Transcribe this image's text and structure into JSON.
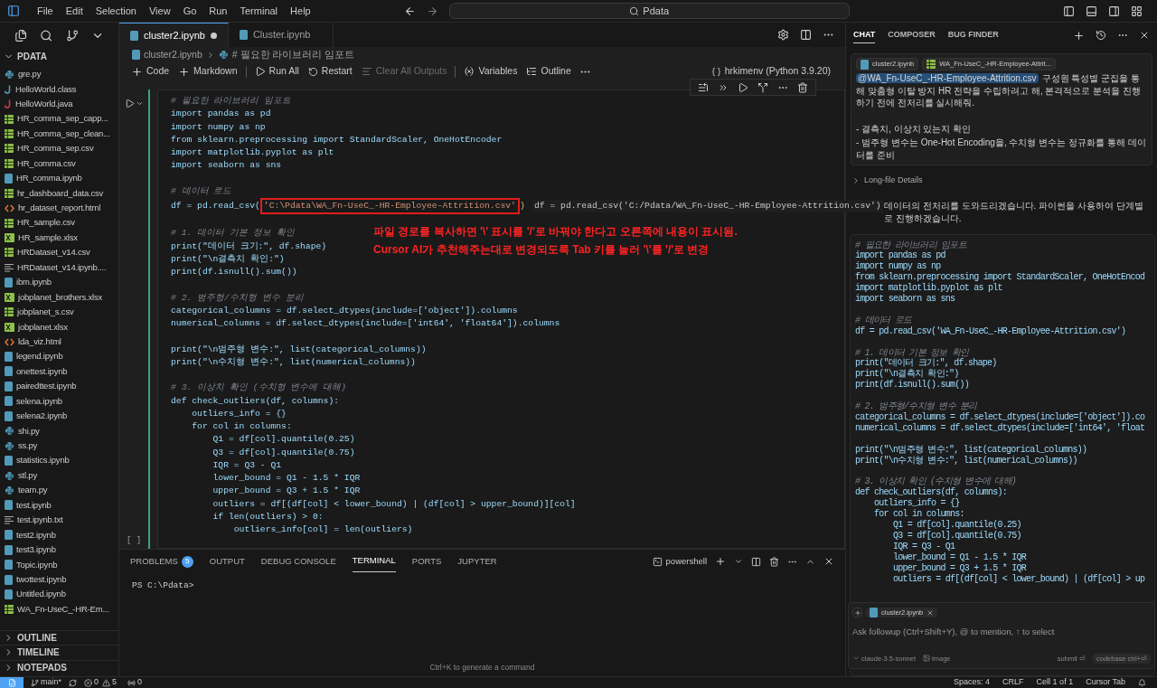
{
  "title_bar": {
    "menu": [
      "File",
      "Edit",
      "Selection",
      "View",
      "Go",
      "Run",
      "Terminal",
      "Help"
    ],
    "search": "Pdata"
  },
  "explorer": {
    "title": "PDATA",
    "files": [
      {
        "name": "gre.py",
        "kind": "py"
      },
      {
        "name": "HelloWorld.class",
        "kind": "class"
      },
      {
        "name": "HelloWorld.java",
        "kind": "java"
      },
      {
        "name": "HR_comma_sep_capp...",
        "kind": "csv"
      },
      {
        "name": "HR_comma_sep_clean...",
        "kind": "csv"
      },
      {
        "name": "HR_comma_sep.csv",
        "kind": "csv"
      },
      {
        "name": "HR_comma.csv",
        "kind": "csv"
      },
      {
        "name": "HR_comma.ipynb",
        "kind": "ipynb"
      },
      {
        "name": "hr_dashboard_data.csv",
        "kind": "csv"
      },
      {
        "name": "hr_dataset_report.html",
        "kind": "html"
      },
      {
        "name": "HR_sample.csv",
        "kind": "csv"
      },
      {
        "name": "HR_sample.xlsx",
        "kind": "xlsx"
      },
      {
        "name": "HRDataset_v14.csv",
        "kind": "csv"
      },
      {
        "name": "HRDataset_v14.ipynb....",
        "kind": "txt"
      },
      {
        "name": "ibm.ipynb",
        "kind": "ipynb"
      },
      {
        "name": "jobplanet_brothers.xlsx",
        "kind": "xlsx"
      },
      {
        "name": "jobplanet_s.csv",
        "kind": "csv"
      },
      {
        "name": "jobplanet.xlsx",
        "kind": "xlsx"
      },
      {
        "name": "lda_viz.html",
        "kind": "html"
      },
      {
        "name": "legend.ipynb",
        "kind": "ipynb"
      },
      {
        "name": "onettest.ipynb",
        "kind": "ipynb"
      },
      {
        "name": "pairedttest.ipynb",
        "kind": "ipynb"
      },
      {
        "name": "selena.ipynb",
        "kind": "ipynb"
      },
      {
        "name": "selena2.ipynb",
        "kind": "ipynb"
      },
      {
        "name": "shi.py",
        "kind": "py"
      },
      {
        "name": "ss.py",
        "kind": "py"
      },
      {
        "name": "statistics.ipynb",
        "kind": "ipynb"
      },
      {
        "name": "stl.py",
        "kind": "py"
      },
      {
        "name": "team.py",
        "kind": "py"
      },
      {
        "name": "test.ipynb",
        "kind": "ipynb"
      },
      {
        "name": "test.ipynb.txt",
        "kind": "txt"
      },
      {
        "name": "test2.ipynb",
        "kind": "ipynb"
      },
      {
        "name": "test3.ipynb",
        "kind": "ipynb"
      },
      {
        "name": "Topic.ipynb",
        "kind": "ipynb"
      },
      {
        "name": "twottest.ipynb",
        "kind": "ipynb"
      },
      {
        "name": "Untitled.ipynb",
        "kind": "ipynb"
      },
      {
        "name": "WA_Fn-UseC_-HR-Em...",
        "kind": "csv"
      }
    ],
    "sections": [
      "OUTLINE",
      "TIMELINE",
      "NOTEPADS"
    ]
  },
  "editor": {
    "tabs": [
      {
        "label": "cluster2.ipynb",
        "selected": true,
        "modified": true
      },
      {
        "label": "Cluster.ipynb",
        "selected": false,
        "modified": false
      }
    ],
    "breadcrumb": [
      "cluster2.ipynb",
      "# 필요한 라이브러리 임포트"
    ],
    "toolbar": [
      {
        "label": "Code",
        "disabled": false
      },
      {
        "label": "Markdown",
        "disabled": false
      },
      {
        "label": "Run All",
        "disabled": false
      },
      {
        "label": "Restart",
        "disabled": false
      },
      {
        "label": "Clear All Outputs",
        "disabled": true
      },
      {
        "label": "Variables",
        "disabled": false
      },
      {
        "label": "Outline",
        "disabled": false
      }
    ],
    "kernel": "hrkimenv (Python 3.9.20)",
    "cell_status": "[ ]",
    "code": [
      {
        "kind": "comment",
        "text": "# 필요한 라이브러리 임포트"
      },
      {
        "kind": "code",
        "text": "import pandas as pd"
      },
      {
        "kind": "code",
        "text": "import numpy as np"
      },
      {
        "kind": "code",
        "text": "from sklearn.preprocessing import StandardScaler, OneHotEncoder"
      },
      {
        "kind": "code",
        "text": "import matplotlib.pyplot as plt"
      },
      {
        "kind": "code",
        "text": "import seaborn as sns"
      },
      {
        "kind": "blank"
      },
      {
        "kind": "comment",
        "text": "# 데이터 로드"
      },
      {
        "kind": "edit",
        "before": "df = pd.read_csv(",
        "boxed": "'C:\\Pdata\\WA_Fn-UseC_-HR-Employee-Attrition.csv'",
        "after": ")",
        "ghost": "df = pd.read_csv('C:/Pdata/WA_Fn-UseC_-HR-Employee-Attrition.csv')"
      },
      {
        "kind": "blank"
      },
      {
        "kind": "comment",
        "text": "# 1. 데이터 기본 정보 확인"
      },
      {
        "kind": "code",
        "text": "print(\"데이터 크기:\", df.shape)"
      },
      {
        "kind": "code",
        "text": "print(\"\\n결측치 확인:\")"
      },
      {
        "kind": "code",
        "text": "print(df.isnull().sum())"
      },
      {
        "kind": "blank"
      },
      {
        "kind": "comment",
        "text": "# 2. 범주형/수치형 변수 분리"
      },
      {
        "kind": "code",
        "text": "categorical_columns = df.select_dtypes(include=['object']).columns"
      },
      {
        "kind": "code",
        "text": "numerical_columns = df.select_dtypes(include=['int64', 'float64']).columns"
      },
      {
        "kind": "blank"
      },
      {
        "kind": "code",
        "text": "print(\"\\n범주형 변수:\", list(categorical_columns))"
      },
      {
        "kind": "code",
        "text": "print(\"\\n수치형 변수:\", list(numerical_columns))"
      },
      {
        "kind": "blank"
      },
      {
        "kind": "comment",
        "text": "# 3. 이상치 확인 (수치형 변수에 대해)"
      },
      {
        "kind": "code",
        "text": "def check_outliers(df, columns):"
      },
      {
        "kind": "code",
        "text": "    outliers_info = {}"
      },
      {
        "kind": "code",
        "text": "    for col in columns:"
      },
      {
        "kind": "code",
        "text": "        Q1 = df[col].quantile(0.25)"
      },
      {
        "kind": "code",
        "text": "        Q3 = df[col].quantile(0.75)"
      },
      {
        "kind": "code",
        "text": "        IQR = Q3 - Q1"
      },
      {
        "kind": "code",
        "text": "        lower_bound = Q1 - 1.5 * IQR"
      },
      {
        "kind": "code",
        "text": "        upper_bound = Q3 + 1.5 * IQR"
      },
      {
        "kind": "code",
        "text": "        outliers = df[(df[col] < lower_bound) | (df[col] > upper_bound)][col]"
      },
      {
        "kind": "code",
        "text": "        if len(outliers) > 0:"
      },
      {
        "kind": "code",
        "text": "            outliers_info[col] = len(outliers)"
      }
    ],
    "annotation": [
      "파일 경로를 복사하면 '\\' 표시를 '/'로 바꿔야 한다고 오른쪽에 내용이 표시됨.",
      "Cursor AI가 추천해주는대로 변경되도록 Tab 키를 눌러 '\\'를 '/'로 변경"
    ]
  },
  "panel": {
    "tabs": [
      {
        "label": "PROBLEMS",
        "selected": false,
        "badge": "5"
      },
      {
        "label": "OUTPUT",
        "selected": false
      },
      {
        "label": "DEBUG CONSOLE",
        "selected": false
      },
      {
        "label": "TERMINAL",
        "selected": true
      },
      {
        "label": "PORTS",
        "selected": false
      },
      {
        "label": "JUPYTER",
        "selected": false
      }
    ],
    "shell": "powershell",
    "prompt": "PS C:\\Pdata>",
    "hint": "Ctrl+K to generate a command"
  },
  "chat": {
    "tabs": [
      {
        "label": "CHAT",
        "selected": true
      },
      {
        "label": "COMPOSER",
        "selected": false
      },
      {
        "label": "BUG FINDER",
        "selected": false
      }
    ],
    "message": {
      "chips": [
        {
          "label": "cluster2.ipynb",
          "kind": "ipynb"
        },
        {
          "label": "WA_Fn-UseC_-HR-Employee-Attrit...",
          "kind": "csv"
        }
      ],
      "mention": "@WA_Fn-UseC_-HR-Employee-Attrition.csv",
      "text": "구성원 특성별 군집을 통해 맞춤형 이탈 방지 HR 전략을 수립하려고 해, 본격적으로 분석을 진행하기 전에 전처리를 실시해줘.",
      "bullets": [
        "- 결측치, 이상치 있는지 확인",
        "- 범주형 변수는 One-Hot Encoding을, 수치형 변수는 정규화를 통해 데이터를 준비"
      ]
    },
    "details": "Long-file Details",
    "reply": "데이터의 전처리를 도와드리겠습니다. 파이썬을 사용하여 단계별로 진행하겠습니다.",
    "code": [
      {
        "kind": "comment",
        "text": "# 필요한 라이브러리 임포트"
      },
      {
        "kind": "code",
        "text": "import pandas as pd"
      },
      {
        "kind": "code",
        "text": "import numpy as np"
      },
      {
        "kind": "code",
        "text": "from sklearn.preprocessing import StandardScaler, OneHotEncod"
      },
      {
        "kind": "code",
        "text": "import matplotlib.pyplot as plt"
      },
      {
        "kind": "code",
        "text": "import seaborn as sns"
      },
      {
        "kind": "blank"
      },
      {
        "kind": "comment",
        "text": "# 데이터 로드"
      },
      {
        "kind": "code",
        "text": "df = pd.read_csv('WA_Fn-UseC_-HR-Employee-Attrition.csv')"
      },
      {
        "kind": "blank"
      },
      {
        "kind": "comment",
        "text": "# 1. 데이터 기본 정보 확인"
      },
      {
        "kind": "code",
        "text": "print(\"데이터 크기:\", df.shape)"
      },
      {
        "kind": "code",
        "text": "print(\"\\n결측치 확인:\")"
      },
      {
        "kind": "code",
        "text": "print(df.isnull().sum())"
      },
      {
        "kind": "blank"
      },
      {
        "kind": "comment",
        "text": "# 2. 범주형/수치형 변수 분리"
      },
      {
        "kind": "code",
        "text": "categorical_columns = df.select_dtypes(include=['object']).co"
      },
      {
        "kind": "code",
        "text": "numerical_columns = df.select_dtypes(include=['int64', 'float"
      },
      {
        "kind": "blank"
      },
      {
        "kind": "code",
        "text": "print(\"\\n범주형 변수:\", list(categorical_columns))"
      },
      {
        "kind": "code",
        "text": "print(\"\\n수치형 변수:\", list(numerical_columns))"
      },
      {
        "kind": "blank"
      },
      {
        "kind": "comment",
        "text": "# 3. 이상치 확인 (수치형 변수에 대해)"
      },
      {
        "kind": "code",
        "text": "def check_outliers(df, columns):"
      },
      {
        "kind": "code",
        "text": "    outliers_info = {}"
      },
      {
        "kind": "code",
        "text": "    for col in columns:"
      },
      {
        "kind": "code",
        "text": "        Q1 = df[col].quantile(0.25)"
      },
      {
        "kind": "code",
        "text": "        Q3 = df[col].quantile(0.75)"
      },
      {
        "kind": "code",
        "text": "        IQR = Q3 - Q1"
      },
      {
        "kind": "code",
        "text": "        lower_bound = Q1 - 1.5 * IQR"
      },
      {
        "kind": "code",
        "text": "        upper_bound = Q3 + 1.5 * IQR"
      },
      {
        "kind": "code",
        "text": "        outliers = df[(df[col] < lower_bound) | (df[col] > up"
      }
    ],
    "input": {
      "chip": "cluster2.ipynb",
      "placeholder": "Ask followup (Ctrl+Shift+Y), @ to mention, ↑ to select",
      "model": "claude-3.5-sonnet",
      "image": "image",
      "submit": "submit ⏎",
      "codebase": "codebase ctrl+⏎"
    }
  },
  "status_bar": {
    "branch": "main*",
    "errors": "0",
    "warnings": "5",
    "ports": "0",
    "right": [
      "Spaces: 4",
      "CRLF",
      "Cell 1 of 1",
      "Cursor Tab"
    ]
  }
}
